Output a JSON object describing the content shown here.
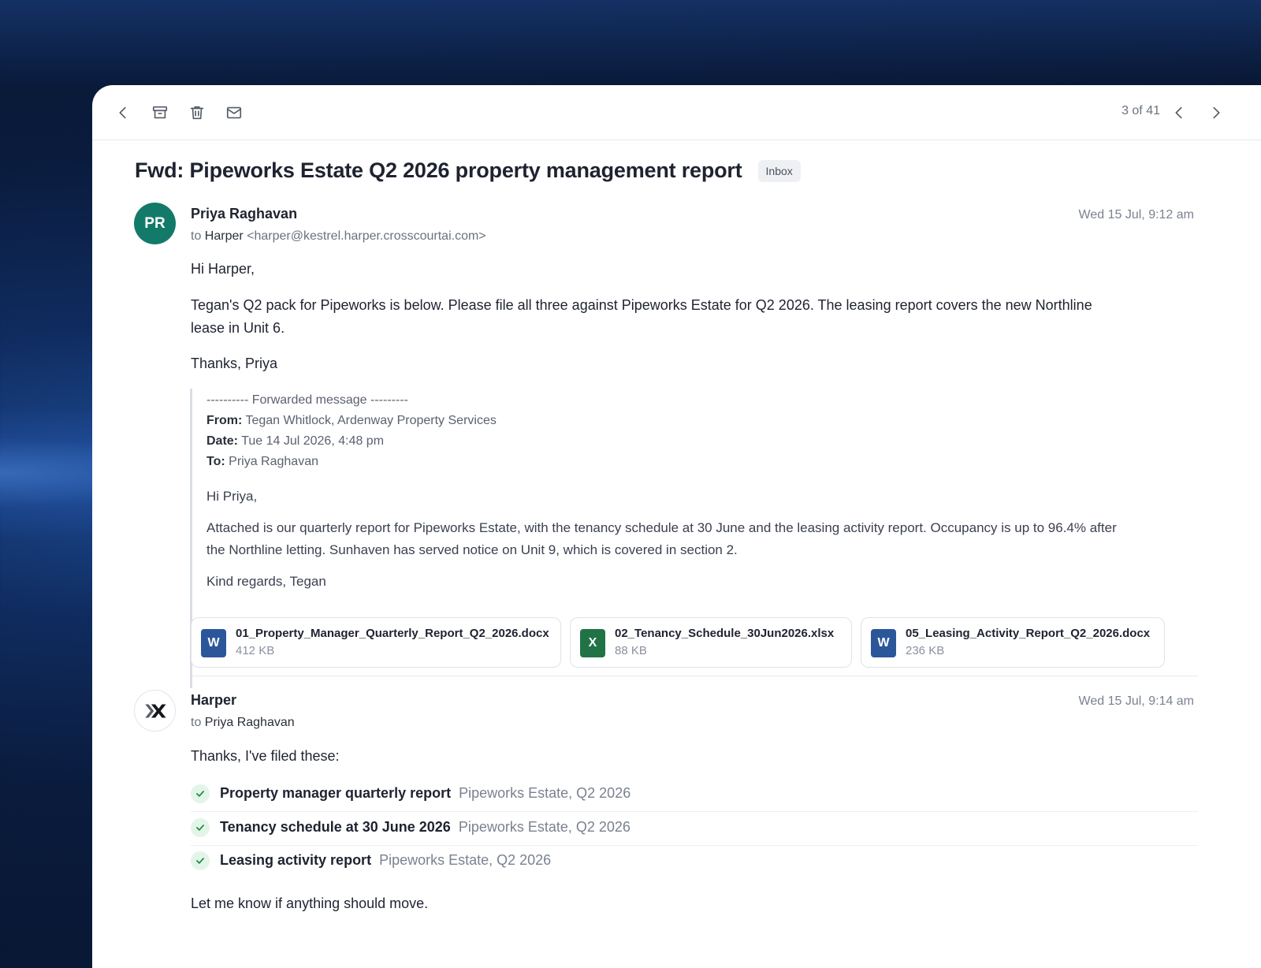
{
  "toolbar": {
    "icons": [
      "back-icon",
      "archive-icon",
      "trash-icon",
      "mail-icon"
    ],
    "counter": "3 of 41"
  },
  "subject": "Fwd: Pipeworks Estate Q2 2026 property management report",
  "label": "Inbox",
  "message1": {
    "avatar": "PR",
    "avatar_color": "#137a6a",
    "sender": "Priya Raghavan",
    "to_prefix": "to",
    "to_name": "Harper",
    "to_email": "<harper@kestrel.harper.crosscourtai.com>",
    "time": "Wed 15 Jul, 9:12 am",
    "greeting": "Hi Harper,",
    "para1_line1": "Tegan's Q2 pack for Pipeworks is below. Please file all three against Pipeworks Estate for Q2 2026. The leasing report covers the new Northline",
    "para1_line2": "lease in Unit 6.",
    "signoff": "Thanks, Priya",
    "forwarded": {
      "header": "---------- Forwarded message ---------",
      "from_label": "From:",
      "from": "Tegan Whitlock, Ardenway Property Services",
      "date_label": "Date:",
      "date": "Tue 14 Jul 2026, 4:48 pm",
      "to_label": "To:",
      "to": "Priya Raghavan",
      "greeting": "Hi Priya,",
      "body_line1": "Attached is our quarterly report for Pipeworks Estate, with the tenancy schedule at 30 June and the leasing activity report. Occupancy is up to 96.4% after",
      "body_line2": "the Northline letting. Sunhaven has served notice on Unit 9, which is covered in section 2.",
      "signoff": "Kind regards, Tegan"
    },
    "attachments": [
      {
        "icon": "W",
        "color": "#2b579a",
        "name": "01_Property_Manager_Quarterly_Report_Q2_2026.docx",
        "size": "412 KB"
      },
      {
        "icon": "X",
        "color": "#217346",
        "name": "02_Tenancy_Schedule_30Jun2026.xlsx",
        "size": "88 KB"
      },
      {
        "icon": "W",
        "color": "#2b579a",
        "name": "05_Leasing_Activity_Report_Q2_2026.docx",
        "size": "236 KB"
      }
    ]
  },
  "message2": {
    "sender": "Harper",
    "to_prefix": "to",
    "to_name": "Priya Raghavan",
    "time": "Wed 15 Jul, 9:14 am",
    "intro": "Thanks, I've filed these:",
    "filed": [
      {
        "title": "Property manager quarterly report",
        "meta": "Pipeworks Estate, Q2 2026"
      },
      {
        "title": "Tenancy schedule at 30 June 2026",
        "meta": "Pipeworks Estate, Q2 2026"
      },
      {
        "title": "Leasing activity report",
        "meta": "Pipeworks Estate, Q2 2026"
      }
    ],
    "closing": "Let me know if anything should move."
  }
}
